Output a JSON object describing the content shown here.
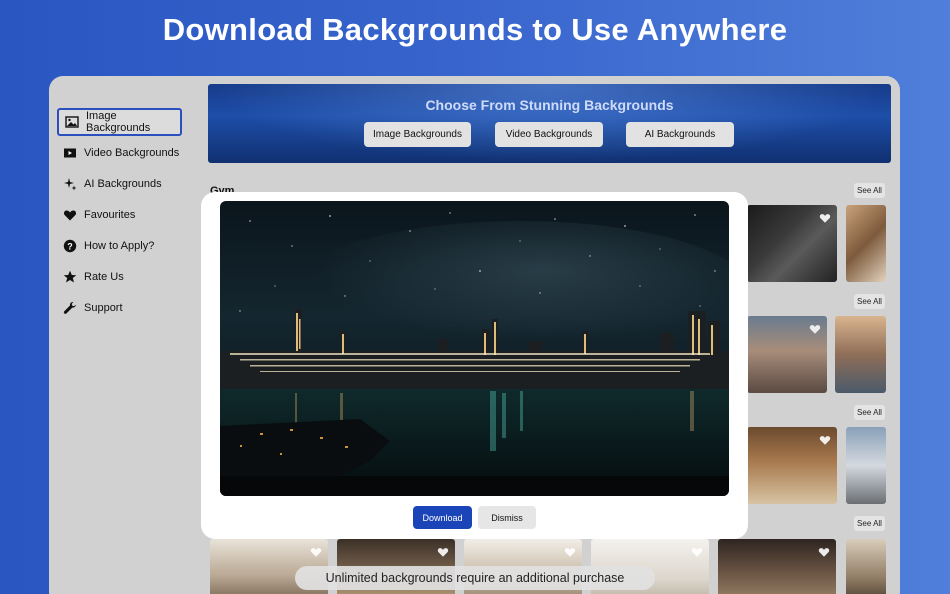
{
  "headline": "Download Backgrounds to Use Anywhere",
  "sidebar": {
    "items": [
      {
        "label": "Image Backgrounds",
        "icon": "image-icon",
        "active": true
      },
      {
        "label": "Video Backgrounds",
        "icon": "video-icon",
        "active": false
      },
      {
        "label": "AI Backgrounds",
        "icon": "sparkles-icon",
        "active": false
      },
      {
        "label": "Favourites",
        "icon": "heart-icon",
        "active": false
      },
      {
        "label": "How to Apply?",
        "icon": "question-icon",
        "active": false
      },
      {
        "label": "Rate Us",
        "icon": "star-icon",
        "active": false
      },
      {
        "label": "Support",
        "icon": "wrench-icon",
        "active": false
      }
    ]
  },
  "banner": {
    "title": "Choose From Stunning Backgrounds",
    "buttons": [
      "Image Backgrounds",
      "Video Backgrounds",
      "AI Backgrounds"
    ]
  },
  "sections": [
    {
      "label": "Gym",
      "see_all": "See All"
    },
    {
      "label": "",
      "see_all": "See All"
    },
    {
      "label": "",
      "see_all": "See All"
    },
    {
      "label": "",
      "see_all": "See All"
    }
  ],
  "modal": {
    "download_label": "Download",
    "dismiss_label": "Dismiss"
  },
  "toast": "Unlimited backgrounds require an additional purchase",
  "colors": {
    "accent": "#1b44b8",
    "page_background": "#2a56c2",
    "window_background": "#d1d1d1"
  }
}
